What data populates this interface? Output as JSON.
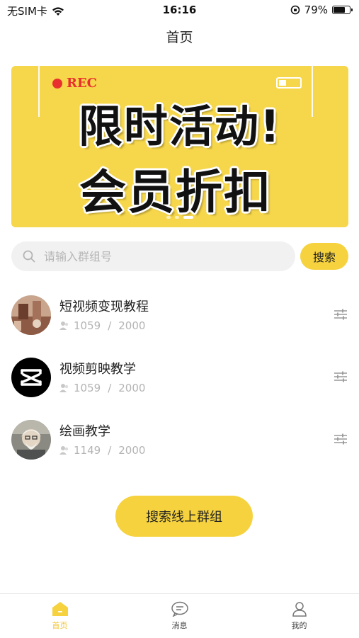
{
  "status_bar": {
    "carrier": "无SIM卡",
    "time": "16:16",
    "battery_percent": "79%"
  },
  "header": {
    "title": "首页"
  },
  "banner": {
    "rec_label": "REC",
    "line1": "限时活动!",
    "line2": "会员折扣",
    "active_slide": 2,
    "slide_count": 3
  },
  "search": {
    "placeholder": "请输入群组号",
    "button_label": "搜索"
  },
  "groups": [
    {
      "name": "短视频变现教程",
      "members": "1059",
      "capacity": "2000",
      "avatar_icon": "photo-avatar"
    },
    {
      "name": "视频剪映教学",
      "members": "1059",
      "capacity": "2000",
      "avatar_icon": "capcut-logo"
    },
    {
      "name": "绘画教学",
      "members": "1149",
      "capacity": "2000",
      "avatar_icon": "portrait-avatar"
    }
  ],
  "count_separator": "/",
  "online_groups_button": "搜索线上群组",
  "tabs": [
    {
      "label": "首页",
      "icon": "home-icon",
      "active": true
    },
    {
      "label": "消息",
      "icon": "message-icon",
      "active": false
    },
    {
      "label": "我的",
      "icon": "profile-icon",
      "active": false
    }
  ],
  "colors": {
    "accent": "#f5d23e",
    "banner_bg": "#f6d64a",
    "tab_active": "#f2c534",
    "muted_text": "#b4b4b4"
  }
}
